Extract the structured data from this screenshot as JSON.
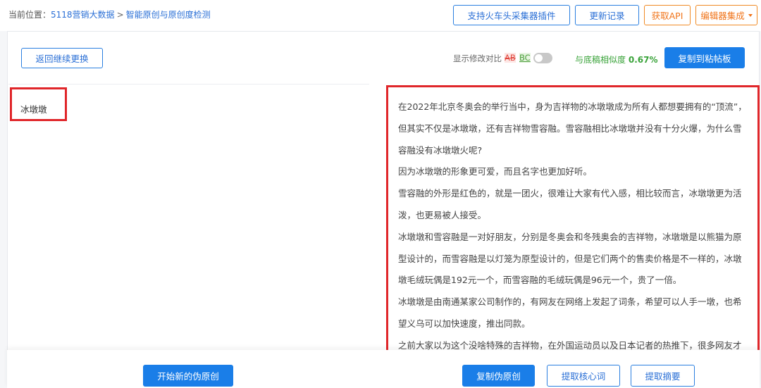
{
  "breadcrumb": {
    "prefix": "当前位置：",
    "items": [
      "5118营销大数据",
      "智能原创与原创度检测"
    ],
    "separator": ">"
  },
  "header_buttons": {
    "plugin": "支持火车头采集器插件",
    "changelog": "更新记录",
    "api": "获取API",
    "editor": "编辑器集成"
  },
  "toolbar": {
    "back": "返回继续更换",
    "diff_label": "显示修改对比",
    "diff_removed": "AB",
    "diff_added": "BC",
    "similarity_label": "与底稿相似度",
    "similarity_value": "0.67%",
    "copy_clipboard": "复制到粘帖板"
  },
  "input": {
    "keyword": "冰墩墩"
  },
  "article": {
    "paragraphs": [
      "在2022年北京冬奥会的举行当中，身为吉祥物的冰墩墩成为所有人都想要拥有的“顶流”，但其实不仅是冰墩墩，还有吉祥物雪容融。雪容融相比冰墩墩并没有十分火爆，为什么雪容融没有冰墩墩火呢?",
      "因为冰墩墩的形象更可爱，而且名字也更加好听。",
      "雪容融的外形是红色的，就是一团火，很难让大家有代入感，相比较而言，冰墩墩更为活泼，也更易被人接受。",
      "冰墩墩和雪容融是一对好朋友，分别是冬奥会和冬残奥会的吉祥物，冰墩墩是以熊猫为原型设计的，而雪容融是以灯笼为原型设计的，但是它们两个的售卖价格是不一样的，冰墩墩毛绒玩偶是192元一个，而雪容融的毛绒玩偶是96元一个，贵了一倍。",
      "冰墩墩是由南通某家公司制作的，有网友在网络上发起了词条，希望可以人手一墩，也希望义乌可以加快速度，推出同款。",
      "之前大家以为这个没啥特殊的吉祥物，在外国运动员以及日本记者的热推下，很多网友才"
    ]
  },
  "bottom": {
    "start_new": "开始新的伪原创",
    "copy_pseudo": "复制伪原创",
    "extract_keywords": "提取核心词",
    "extract_summary": "提取摘要"
  },
  "colors": {
    "accent": "#1a7ee8",
    "highlight_border": "#e0262a",
    "similarity": "#3aa33a",
    "orange": "#f0741a"
  }
}
